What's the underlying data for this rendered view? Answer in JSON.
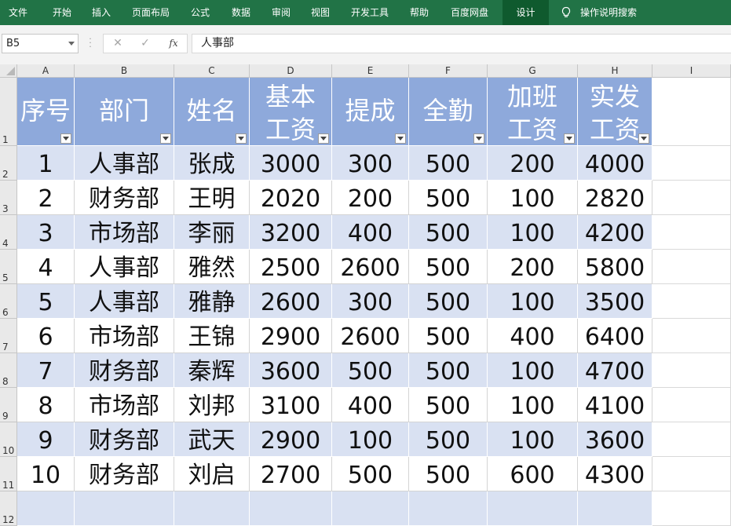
{
  "ribbon": {
    "tabs": [
      "文件",
      "开始",
      "插入",
      "页面布局",
      "公式",
      "数据",
      "审阅",
      "视图",
      "开发工具",
      "帮助",
      "百度网盘",
      "设计"
    ],
    "active_tab": "设计",
    "search_label": "操作说明搜索",
    "color": "#217346"
  },
  "formula_bar": {
    "name_box": "B5",
    "cancel_icon": "✕",
    "enter_icon": "✓",
    "fx_label": "fx",
    "value": "人事部"
  },
  "sheet": {
    "columns": [
      "A",
      "B",
      "C",
      "D",
      "E",
      "F",
      "G",
      "H",
      "I"
    ],
    "row_numbers": [
      "1",
      "2",
      "3",
      "4",
      "5",
      "6",
      "7",
      "8",
      "9",
      "10",
      "11",
      "12"
    ],
    "headers": [
      {
        "line1": "序号",
        "line2": ""
      },
      {
        "line1": "部门",
        "line2": ""
      },
      {
        "line1": "姓名",
        "line2": ""
      },
      {
        "line1": "基本",
        "line2": "工资"
      },
      {
        "line1": "提成",
        "line2": ""
      },
      {
        "line1": "全勤",
        "line2": ""
      },
      {
        "line1": "加班",
        "line2": "工资"
      },
      {
        "line1": "实发",
        "line2": "工资"
      }
    ],
    "rows": [
      [
        "1",
        "人事部",
        "张成",
        "3000",
        "300",
        "500",
        "200",
        "4000"
      ],
      [
        "2",
        "财务部",
        "王明",
        "2020",
        "200",
        "500",
        "100",
        "2820"
      ],
      [
        "3",
        "市场部",
        "李丽",
        "3200",
        "400",
        "500",
        "100",
        "4200"
      ],
      [
        "4",
        "人事部",
        "雅然",
        "2500",
        "2600",
        "500",
        "200",
        "5800"
      ],
      [
        "5",
        "人事部",
        "雅静",
        "2600",
        "300",
        "500",
        "100",
        "3500"
      ],
      [
        "6",
        "市场部",
        "王锦",
        "2900",
        "2600",
        "500",
        "400",
        "6400"
      ],
      [
        "7",
        "财务部",
        "秦辉",
        "3600",
        "500",
        "500",
        "100",
        "4700"
      ],
      [
        "8",
        "市场部",
        "刘邦",
        "3100",
        "400",
        "500",
        "100",
        "4100"
      ],
      [
        "9",
        "财务部",
        "武天",
        "2900",
        "100",
        "500",
        "100",
        "3600"
      ],
      [
        "10",
        "财务部",
        "刘启",
        "2700",
        "500",
        "500",
        "600",
        "4300"
      ]
    ],
    "colors": {
      "header_fill": "#8ea9db",
      "band_fill": "#d9e1f2",
      "plain_fill": "#ffffff"
    }
  }
}
